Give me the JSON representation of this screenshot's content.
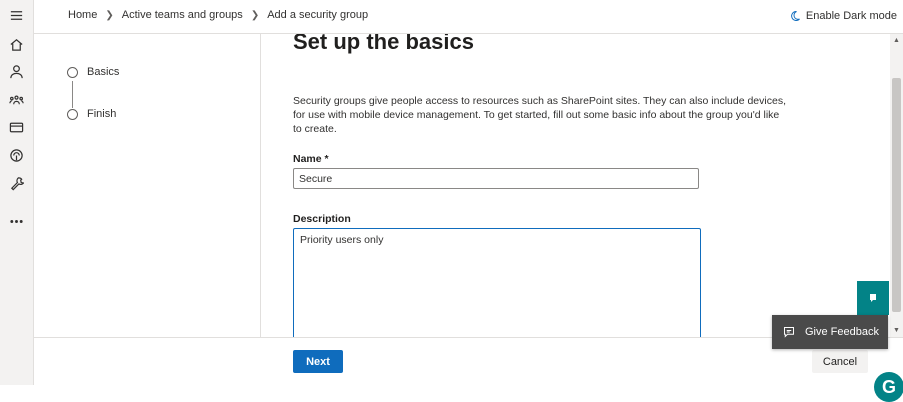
{
  "breadcrumb": [
    "Home",
    "Active teams and groups",
    "Add a security group"
  ],
  "dark_mode_label": "Enable Dark mode",
  "steps": [
    {
      "label": "Basics"
    },
    {
      "label": "Finish"
    }
  ],
  "main": {
    "heading": "Set up the basics",
    "description": "Security groups give people access to resources such as SharePoint sites. They can also include devices, for use with mobile device management. To get started, fill out some basic info about the group you'd like to create.",
    "name_label": "Name *",
    "name_value": "Secure",
    "description_label": "Description",
    "description_value": "Priority users only"
  },
  "footer": {
    "next_label": "Next",
    "cancel_label": "Cancel"
  },
  "feedback_label": "Give Feedback",
  "help_glyph": "G",
  "nav_icons": [
    "hamburger-icon",
    "home-icon",
    "user-icon",
    "groups-icon",
    "billing-icon",
    "support-icon",
    "wrench-icon",
    "more-icon"
  ],
  "colors": {
    "accent": "#0f6cbd",
    "teal": "#038387"
  }
}
